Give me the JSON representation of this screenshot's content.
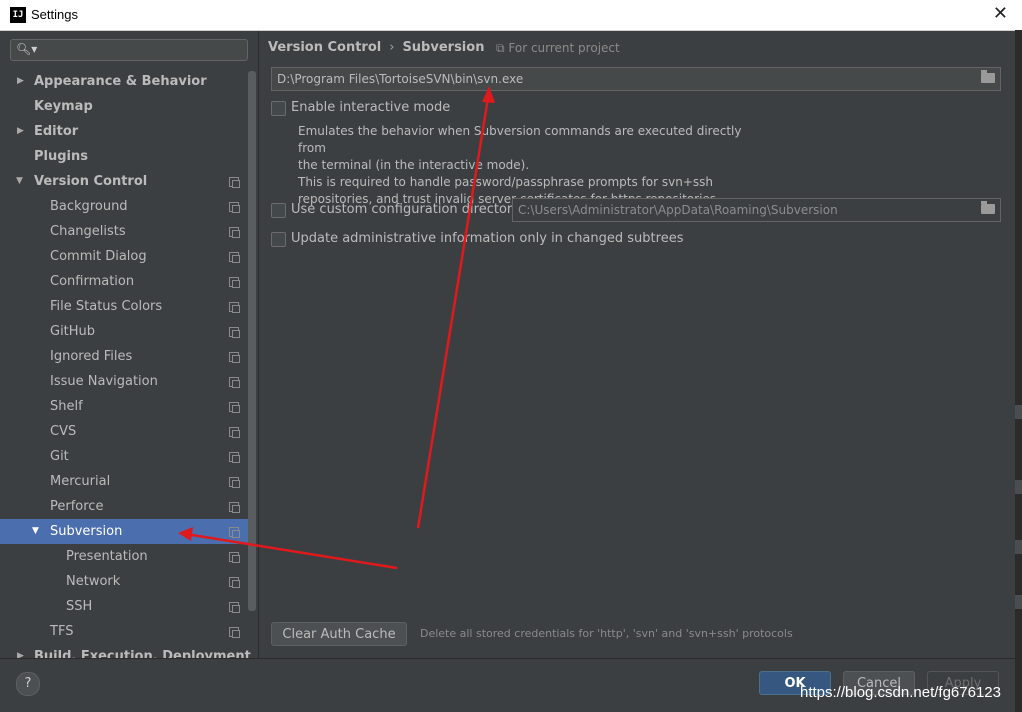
{
  "window": {
    "title": "Settings",
    "app_icon_text": "IJ",
    "close_glyph": "✕"
  },
  "sidebar": {
    "search_placeholder": "",
    "items": [
      {
        "label": "Appearance & Behavior"
      },
      {
        "label": "Keymap"
      },
      {
        "label": "Editor"
      },
      {
        "label": "Plugins"
      },
      {
        "label": "Version Control"
      },
      {
        "label": "Background"
      },
      {
        "label": "Changelists"
      },
      {
        "label": "Commit Dialog"
      },
      {
        "label": "Confirmation"
      },
      {
        "label": "File Status Colors"
      },
      {
        "label": "GitHub"
      },
      {
        "label": "Ignored Files"
      },
      {
        "label": "Issue Navigation"
      },
      {
        "label": "Shelf"
      },
      {
        "label": "CVS"
      },
      {
        "label": "Git"
      },
      {
        "label": "Mercurial"
      },
      {
        "label": "Perforce"
      },
      {
        "label": "Subversion"
      },
      {
        "label": "Presentation"
      },
      {
        "label": "Network"
      },
      {
        "label": "SSH"
      },
      {
        "label": "TFS"
      },
      {
        "label": "Build, Execution, Deployment"
      }
    ]
  },
  "breadcrumb": {
    "root": "Version Control",
    "separator": "›",
    "current": "Subversion",
    "scope": "For current project"
  },
  "main": {
    "svn_path": "D:\\Program Files\\TortoiseSVN\\bin\\svn.exe",
    "interactive_label": "Enable interactive mode",
    "interactive_desc": [
      "Emulates the behavior when Subversion commands are executed directly from",
      "the terminal (in the interactive mode).",
      "This is required to handle password/passphrase prompts for svn+ssh",
      "repositories, and trust invalid server certificates for https repositories."
    ],
    "custom_config_label": "Use custom configuration directory:",
    "custom_config_path": "C:\\Users\\Administrator\\AppData\\Roaming\\Subversion",
    "update_admin_label": "Update administrative information only in changed subtrees",
    "clear_cache_label": "Clear Auth Cache",
    "clear_cache_note": "Delete all stored credentials for 'http', 'svn' and 'svn+ssh' protocols"
  },
  "footer": {
    "help": "?",
    "ok": "OK",
    "cancel": "Cancel",
    "apply": "Apply"
  },
  "watermark": "https://blog.csdn.net/fg676123",
  "colors": {
    "selection": "#4b6eaf",
    "annotation_arrow": "#e0191d",
    "panel_bg": "#3c3f41"
  }
}
